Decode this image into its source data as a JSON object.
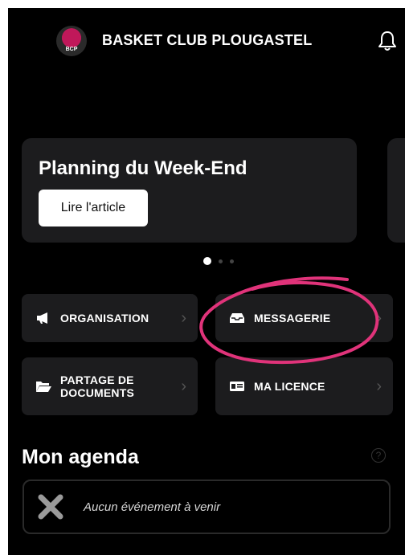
{
  "header": {
    "title": "BASKET CLUB PLOUGASTEL",
    "logo_text": "BCP",
    "logo_icon": "club-logo",
    "notification_icon": "bell-icon"
  },
  "carousel": {
    "cards": [
      {
        "title": "Planning du Week-End",
        "button_label": "Lire l'article"
      }
    ],
    "page_count": 3,
    "active_page": 1
  },
  "tiles": [
    {
      "label": "ORGANISATION",
      "icon": "megaphone-icon"
    },
    {
      "label": "MESSAGERIE",
      "icon": "inbox-icon"
    },
    {
      "label_line1": "PARTAGE DE",
      "label_line2": "DOCUMENTS",
      "icon": "folder-icon"
    },
    {
      "label": "MA LICENCE",
      "icon": "id-card-icon"
    }
  ],
  "agenda": {
    "title": "Mon agenda",
    "help_icon": "help-icon",
    "empty_text": "Aucun événement à venir",
    "empty_icon": "x-icon"
  },
  "colors": {
    "background": "#000000",
    "card": "#1c1c1e",
    "annotation": "#e0337a"
  }
}
